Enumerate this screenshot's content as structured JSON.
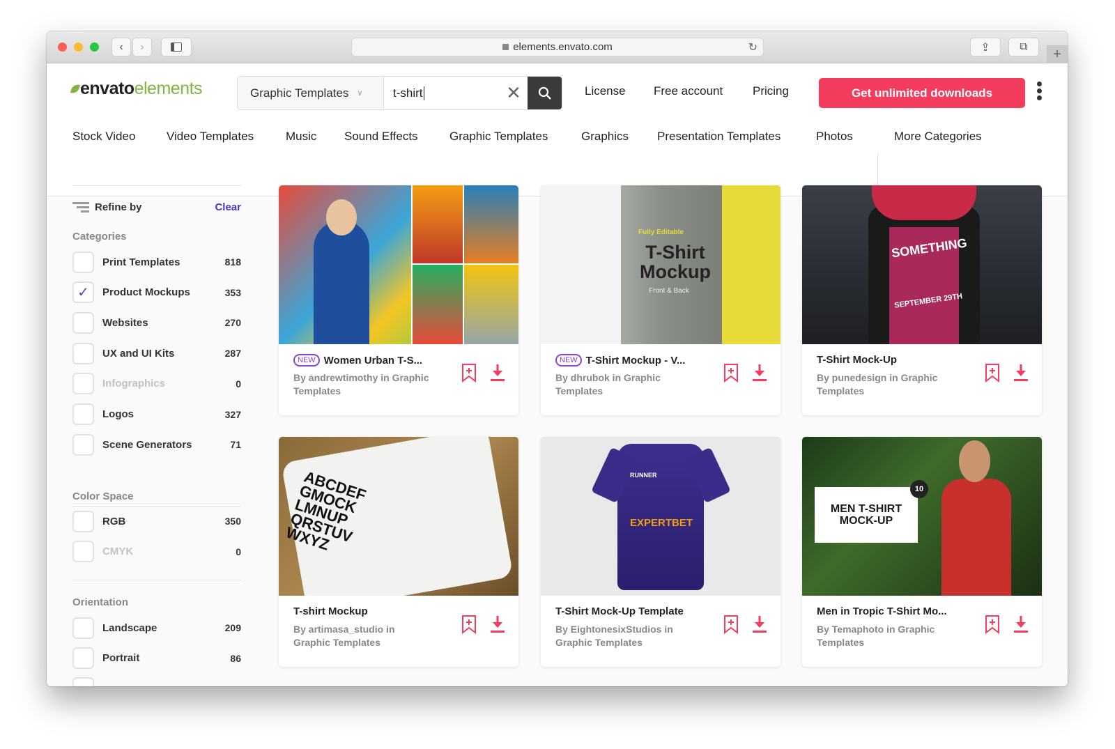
{
  "browser": {
    "url": "elements.envato.com"
  },
  "header": {
    "logo": {
      "part1": "envato",
      "part2": "elements"
    },
    "search": {
      "category": "Graphic Templates",
      "query": "t-shirt"
    },
    "links": [
      "License",
      "Free account",
      "Pricing"
    ],
    "cta": "Get unlimited downloads"
  },
  "nav": [
    "Stock Video",
    "Video Templates",
    "Music",
    "Sound Effects",
    "Graphic Templates",
    "Graphics",
    "Presentation Templates",
    "Photos",
    "More Categories"
  ],
  "sidebar": {
    "refine": "Refine by",
    "clear": "Clear",
    "categories_title": "Categories",
    "categories": [
      {
        "label": "Print Templates",
        "count": "818",
        "checked": false
      },
      {
        "label": "Product Mockups",
        "count": "353",
        "checked": true
      },
      {
        "label": "Websites",
        "count": "270",
        "checked": false
      },
      {
        "label": "UX and UI Kits",
        "count": "287",
        "checked": false
      },
      {
        "label": "Infographics",
        "count": "0",
        "checked": false,
        "disabled": true
      },
      {
        "label": "Logos",
        "count": "327",
        "checked": false
      },
      {
        "label": "Scene Generators",
        "count": "71",
        "checked": false
      }
    ],
    "color_title": "Color Space",
    "color": [
      {
        "label": "RGB",
        "count": "350"
      },
      {
        "label": "CMYK",
        "count": "0",
        "disabled": true
      }
    ],
    "orientation_title": "Orientation",
    "orientation": [
      {
        "label": "Landscape",
        "count": "209"
      },
      {
        "label": "Portrait",
        "count": "86"
      }
    ]
  },
  "accent": "#f43c5e",
  "new_badge": "NEW",
  "cards": [
    {
      "title": "Women Urban T-S...",
      "author": "By andrewtimothy in Graphic Templates",
      "new": true
    },
    {
      "title": "T-Shirt Mockup - V...",
      "author": "By dhrubok in Graphic Templates",
      "new": true,
      "thumb": {
        "tag": "Fully Editable",
        "title1": "T-Shirt",
        "title2": "Mockup",
        "sub": "Front & Back"
      }
    },
    {
      "title": "T-Shirt Mock-Up",
      "author": "By punedesign in Graphic Templates",
      "new": false,
      "thumb": {
        "text": "SOMETHING",
        "date": "SEPTEMBER 29TH"
      }
    },
    {
      "title": "T-shirt Mockup",
      "author": "By artimasa_studio in Graphic Templates",
      "new": false,
      "thumb": {
        "text": "ABCDEF GMOCK LMNUP QRSTUV WXYZ"
      }
    },
    {
      "title": "T-Shirt Mock-Up Template",
      "author": "By EightonesixStudios in Graphic Templates",
      "new": false,
      "thumb": {
        "text": "EXPERTBET",
        "sub": "RUNNER"
      }
    },
    {
      "title": "Men in Tropic T-Shirt Mo...",
      "author": "By Temaphoto in Graphic Templates",
      "new": false,
      "thumb": {
        "text": "MEN T-SHIRT MOCK-UP",
        "badge": "10"
      }
    }
  ]
}
